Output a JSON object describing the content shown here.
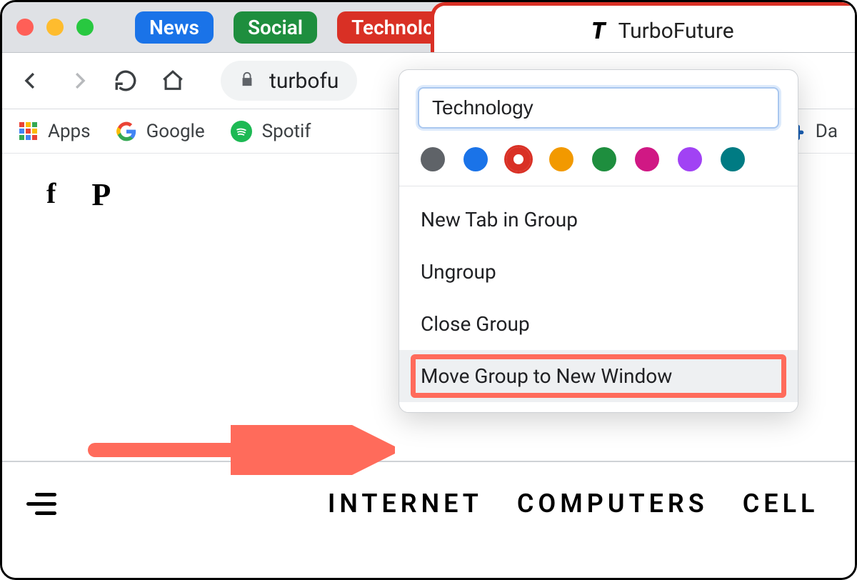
{
  "tabstrip": {
    "groups": [
      "News",
      "Social",
      "Technology"
    ],
    "active_tab_title": "TurboFuture"
  },
  "toolbar": {
    "url_display": "turbofu"
  },
  "bookmarks": {
    "apps": "Apps",
    "google": "Google",
    "spotify": "Spotif",
    "right_label": "Da"
  },
  "popup": {
    "group_name": "Technology",
    "colors": [
      "#5f6368",
      "#1a73e8",
      "#d93025",
      "#f29900",
      "#1e8e3e",
      "#d01884",
      "#a142f4",
      "#007b83"
    ],
    "selected_color_index": 2,
    "menu": {
      "new_tab": "New Tab in Group",
      "ungroup": "Ungroup",
      "close": "Close Group",
      "move": "Move Group to New Window"
    }
  },
  "page": {
    "nav": [
      "INTERNET",
      "COMPUTERS",
      "CELL"
    ]
  }
}
